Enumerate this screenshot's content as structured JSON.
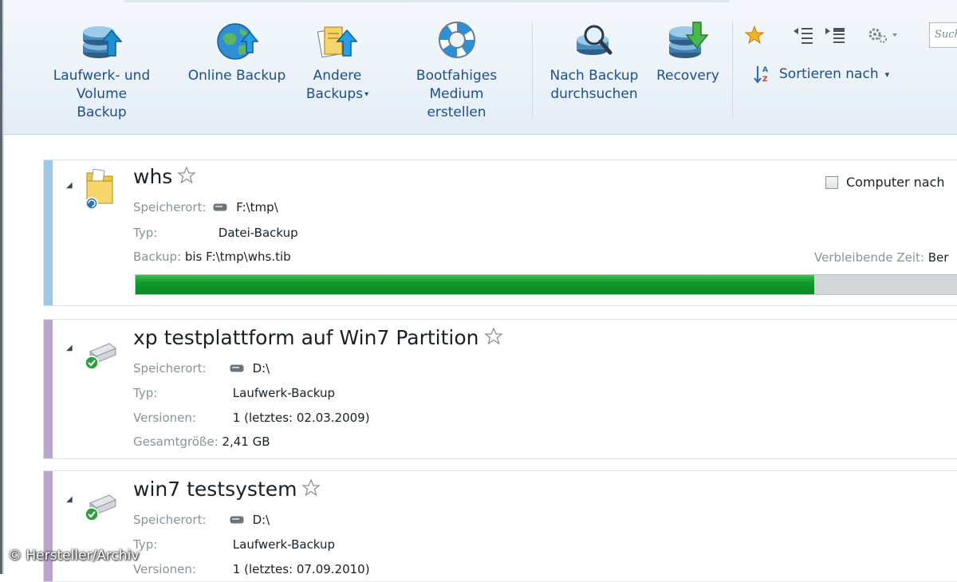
{
  "toolbar": {
    "buttons": [
      {
        "label": "Laufwerk- und\nVolume\nBackup",
        "icon": "disk-backup-icon"
      },
      {
        "label": "Online Backup",
        "icon": "globe-upload-icon"
      },
      {
        "label": "Andere\nBackups",
        "icon": "files-upload-icon"
      },
      {
        "label": "Bootfahiges\nMedium\nerstellen",
        "icon": "lifebuoy-icon"
      },
      {
        "label": "Nach Backup\ndurchsuchen",
        "icon": "disk-search-icon"
      },
      {
        "label": "Recovery",
        "icon": "disk-restore-icon"
      }
    ],
    "dropdown_arrow": "▾",
    "sort_label": "Sortieren nach",
    "search_placeholder": "Such"
  },
  "backups": [
    {
      "title": "whs",
      "location_label": "Speicherort:",
      "location": "F:\\tmp\\",
      "type_label": "Typ:",
      "type": "Datei-Backup",
      "backup_label": "Backup:",
      "backup_value": "bis F:\\tmp\\whs.tib",
      "progress_percent": 81,
      "checkbox_label": "Computer nach",
      "remaining_label": "Verbleibende Zeit:",
      "remaining_value": "Ber",
      "accent": "#9cc8ea"
    },
    {
      "title": "xp testplattform auf Win7 Partition",
      "location_label": "Speicherort:",
      "location": "D:\\",
      "type_label": "Typ:",
      "type": "Laufwerk-Backup",
      "versions_label": "Versionen:",
      "versions": "1 (letztes: 02.03.2009)",
      "size_label": "Gesamtgröße:",
      "size": "2,41 GB",
      "accent": "#b9a3cf"
    },
    {
      "title": "win7 testsystem",
      "location_label": "Speicherort:",
      "location": "D:\\",
      "type_label": "Typ:",
      "type": "Laufwerk-Backup",
      "versions_label": "Versionen:",
      "versions": "1 (letztes: 07.09.2010)",
      "accent": "#b9a3cf"
    }
  ],
  "copyright": "© Hersteller/Archiv"
}
